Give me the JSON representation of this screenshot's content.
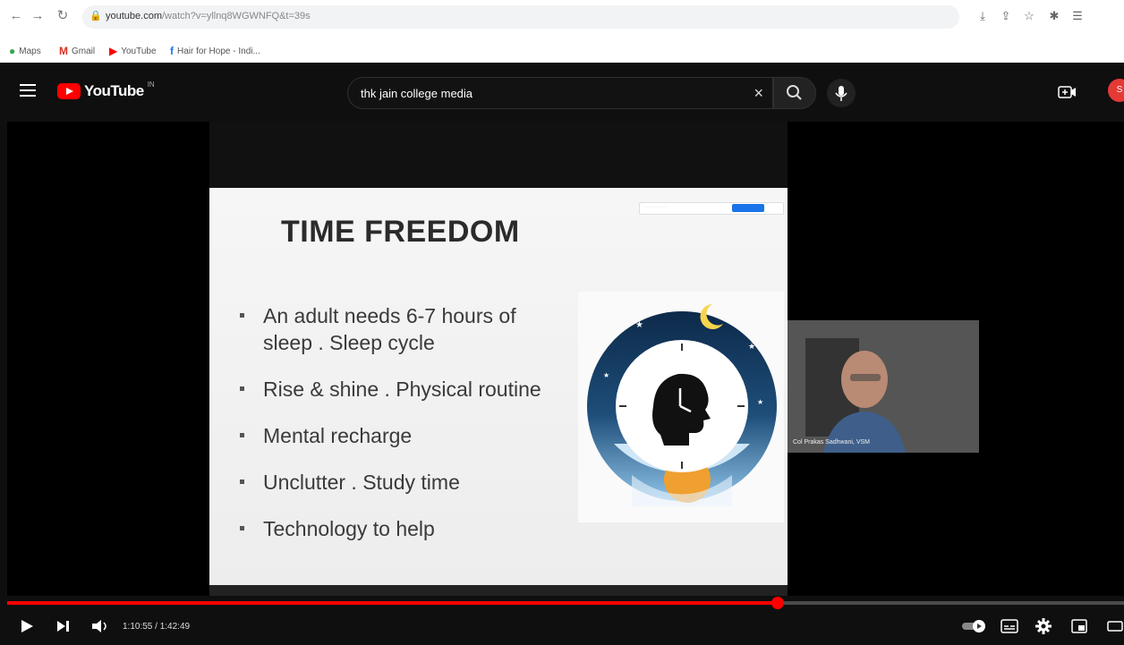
{
  "browser": {
    "url_host": "youtube.com",
    "url_path": "/watch?v=yllnq8WGWNFQ&t=39s",
    "bookmarks": [
      {
        "label": "Maps",
        "icon": "maps-pin-icon",
        "color": "#34a853"
      },
      {
        "label": "Gmail",
        "icon": "gmail-icon",
        "color": "#d93025"
      },
      {
        "label": "YouTube",
        "icon": "youtube-icon",
        "color": "#ff0000"
      },
      {
        "label": "Hair for Hope - Indi...",
        "icon": "facebook-icon",
        "color": "#1877f2"
      }
    ]
  },
  "youtube": {
    "logo_text": "YouTube",
    "country_code": "IN",
    "search_query": "thk jain college media",
    "avatar_initial": "S"
  },
  "slide": {
    "title": "TIME FREEDOM",
    "bullets": [
      "An adult needs 6-7 hours of sleep . Sleep cycle",
      "Rise & shine . Physical routine",
      "Mental recharge",
      "Unclutter . Study time",
      "Technology to help"
    ]
  },
  "speaker": {
    "name": "Col Prakas Sadhwani, VSM"
  },
  "player": {
    "time_display": "1:10:55 / 1:42:49",
    "progress_fraction": 0.6897,
    "accent": "#ff0000"
  }
}
